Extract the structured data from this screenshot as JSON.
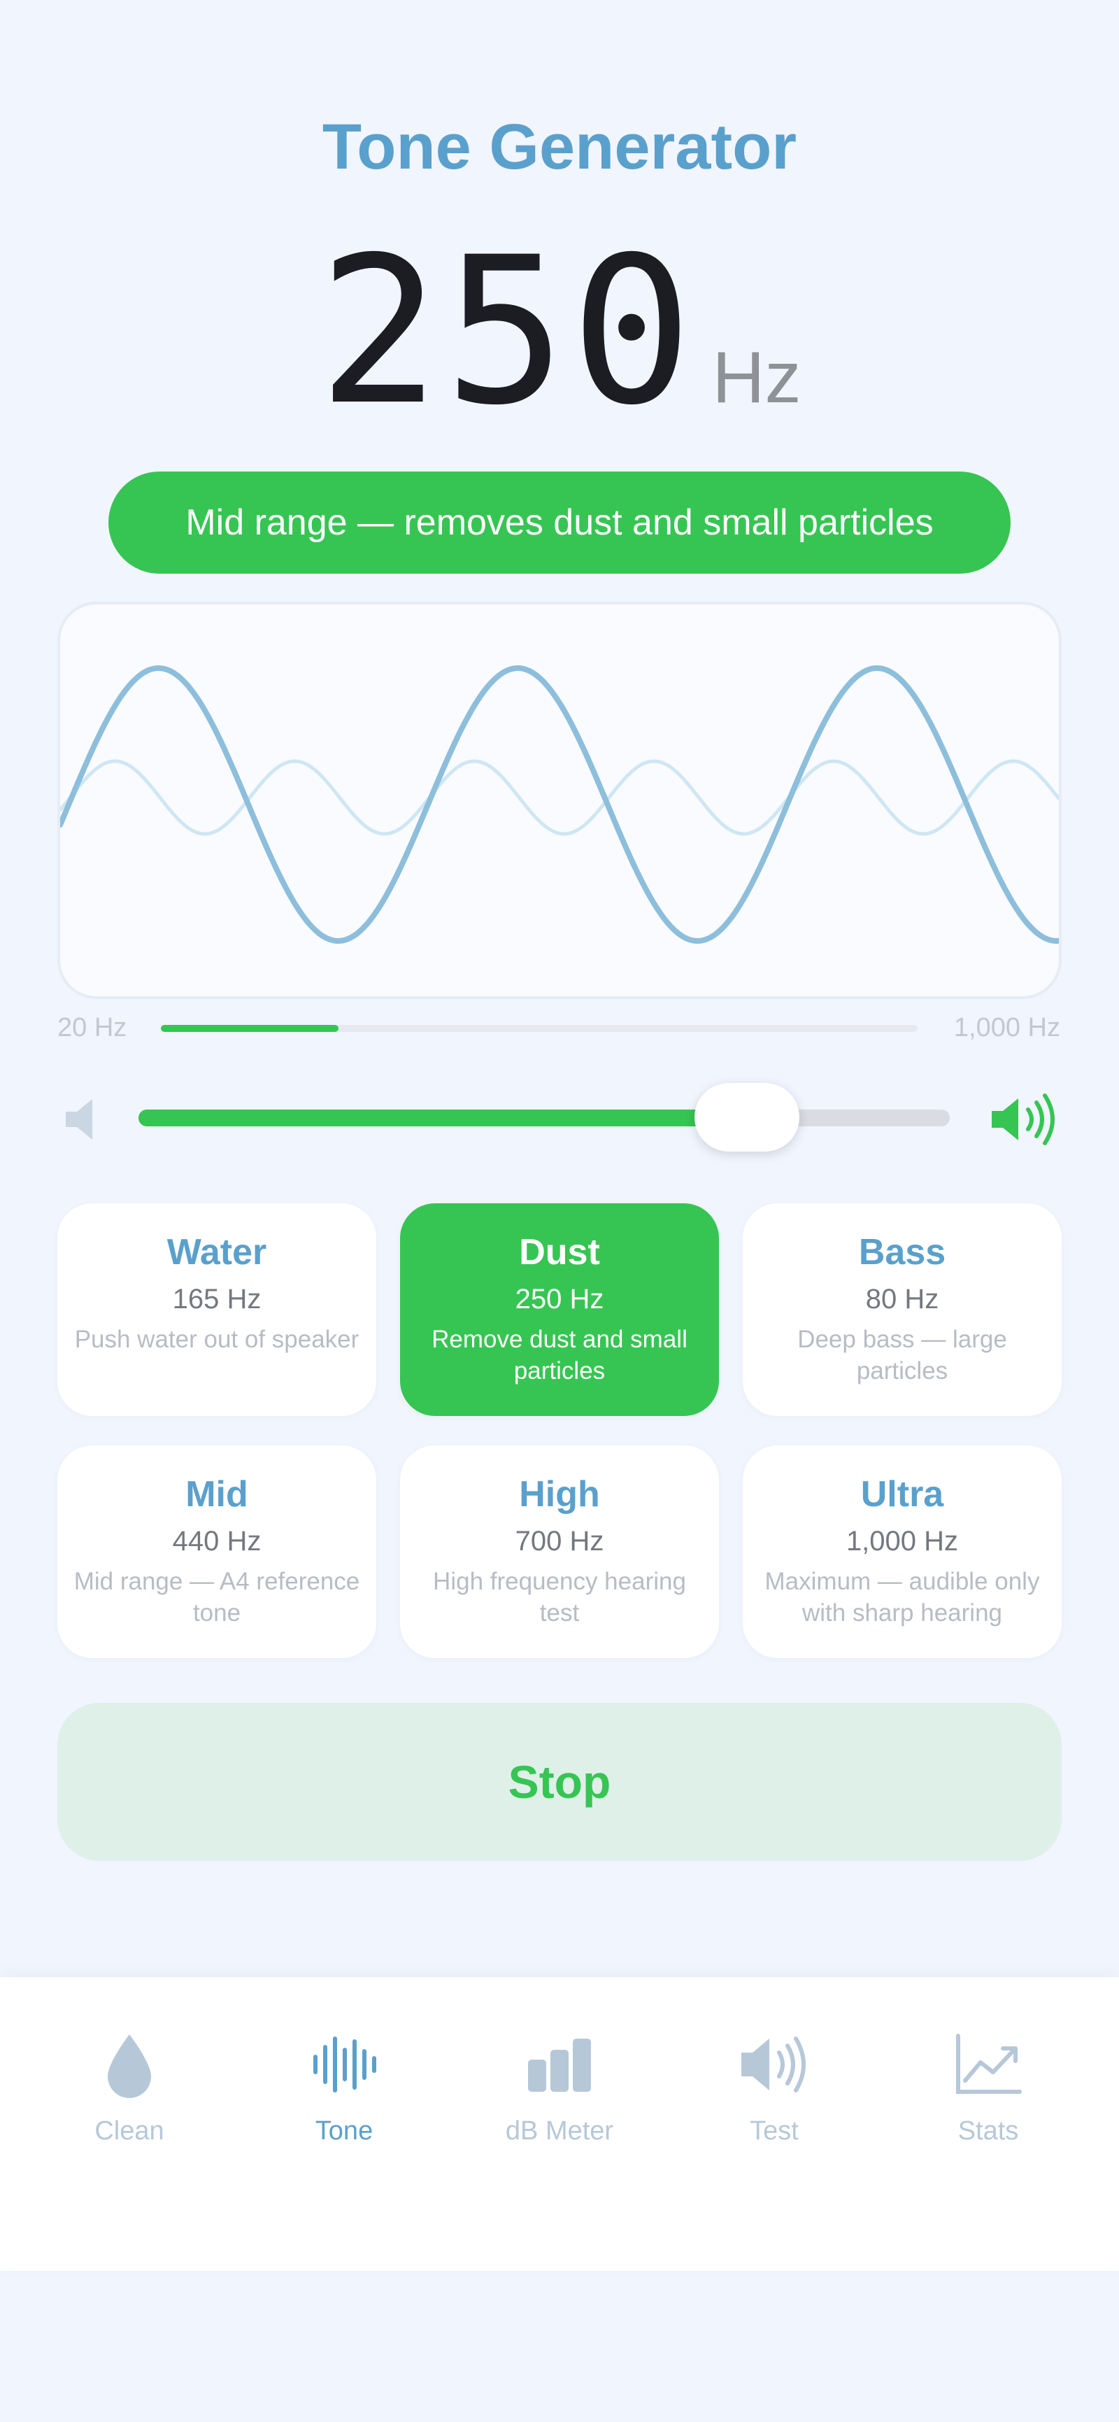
{
  "app": {
    "title": "Tone Generator"
  },
  "frequency": {
    "value": "250",
    "unit": "Hz"
  },
  "badge": {
    "text": "Mid range — removes dust and small particles"
  },
  "range": {
    "min_label": "20 Hz",
    "max_label": "1,000 Hz",
    "min_hz": 20,
    "max_hz": 1000,
    "current_hz": 250
  },
  "volume": {
    "level": 0.75
  },
  "presets": [
    {
      "name": "Water",
      "hz": "165 Hz",
      "desc": "Push water out of speaker",
      "active": false
    },
    {
      "name": "Dust",
      "hz": "250 Hz",
      "desc": "Remove dust and small particles",
      "active": true
    },
    {
      "name": "Bass",
      "hz": "80 Hz",
      "desc": "Deep bass — large particles",
      "active": false
    },
    {
      "name": "Mid",
      "hz": "440 Hz",
      "desc": "Mid range — A4 reference tone",
      "active": false
    },
    {
      "name": "High",
      "hz": "700 Hz",
      "desc": "High frequency hearing test",
      "active": false
    },
    {
      "name": "Ultra",
      "hz": "1,000 Hz",
      "desc": "Maximum — audible only with sharp hearing",
      "active": false
    }
  ],
  "stop_button": {
    "label": "Stop"
  },
  "tabs": [
    {
      "label": "Clean",
      "icon": "drop-icon",
      "active": false
    },
    {
      "label": "Tone",
      "icon": "waveform-icon",
      "active": true
    },
    {
      "label": "dB Meter",
      "icon": "bars-icon",
      "active": false
    },
    {
      "label": "Test",
      "icon": "speaker-icon",
      "active": false
    },
    {
      "label": "Stats",
      "icon": "chart-icon",
      "active": false
    }
  ],
  "colors": {
    "accent_blue": "#5aa0cc",
    "accent_green": "#36c552",
    "wave_primary": "#8dbedb",
    "wave_secondary": "#cfe6f3",
    "tab_inactive": "#b6c8d8",
    "background": "#f1f5fd"
  }
}
